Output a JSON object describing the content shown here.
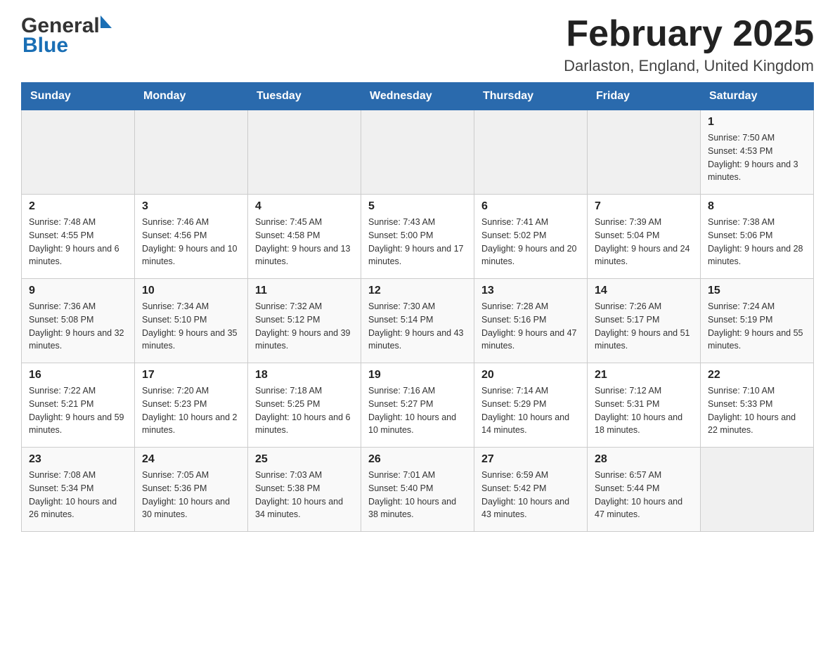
{
  "header": {
    "logo_general": "General",
    "logo_blue": "Blue",
    "month_title": "February 2025",
    "location": "Darlaston, England, United Kingdom"
  },
  "days_of_week": [
    "Sunday",
    "Monday",
    "Tuesday",
    "Wednesday",
    "Thursday",
    "Friday",
    "Saturday"
  ],
  "weeks": [
    {
      "cells": [
        {
          "day": "",
          "info": ""
        },
        {
          "day": "",
          "info": ""
        },
        {
          "day": "",
          "info": ""
        },
        {
          "day": "",
          "info": ""
        },
        {
          "day": "",
          "info": ""
        },
        {
          "day": "",
          "info": ""
        },
        {
          "day": "1",
          "info": "Sunrise: 7:50 AM\nSunset: 4:53 PM\nDaylight: 9 hours and 3 minutes."
        }
      ]
    },
    {
      "cells": [
        {
          "day": "2",
          "info": "Sunrise: 7:48 AM\nSunset: 4:55 PM\nDaylight: 9 hours and 6 minutes."
        },
        {
          "day": "3",
          "info": "Sunrise: 7:46 AM\nSunset: 4:56 PM\nDaylight: 9 hours and 10 minutes."
        },
        {
          "day": "4",
          "info": "Sunrise: 7:45 AM\nSunset: 4:58 PM\nDaylight: 9 hours and 13 minutes."
        },
        {
          "day": "5",
          "info": "Sunrise: 7:43 AM\nSunset: 5:00 PM\nDaylight: 9 hours and 17 minutes."
        },
        {
          "day": "6",
          "info": "Sunrise: 7:41 AM\nSunset: 5:02 PM\nDaylight: 9 hours and 20 minutes."
        },
        {
          "day": "7",
          "info": "Sunrise: 7:39 AM\nSunset: 5:04 PM\nDaylight: 9 hours and 24 minutes."
        },
        {
          "day": "8",
          "info": "Sunrise: 7:38 AM\nSunset: 5:06 PM\nDaylight: 9 hours and 28 minutes."
        }
      ]
    },
    {
      "cells": [
        {
          "day": "9",
          "info": "Sunrise: 7:36 AM\nSunset: 5:08 PM\nDaylight: 9 hours and 32 minutes."
        },
        {
          "day": "10",
          "info": "Sunrise: 7:34 AM\nSunset: 5:10 PM\nDaylight: 9 hours and 35 minutes."
        },
        {
          "day": "11",
          "info": "Sunrise: 7:32 AM\nSunset: 5:12 PM\nDaylight: 9 hours and 39 minutes."
        },
        {
          "day": "12",
          "info": "Sunrise: 7:30 AM\nSunset: 5:14 PM\nDaylight: 9 hours and 43 minutes."
        },
        {
          "day": "13",
          "info": "Sunrise: 7:28 AM\nSunset: 5:16 PM\nDaylight: 9 hours and 47 minutes."
        },
        {
          "day": "14",
          "info": "Sunrise: 7:26 AM\nSunset: 5:17 PM\nDaylight: 9 hours and 51 minutes."
        },
        {
          "day": "15",
          "info": "Sunrise: 7:24 AM\nSunset: 5:19 PM\nDaylight: 9 hours and 55 minutes."
        }
      ]
    },
    {
      "cells": [
        {
          "day": "16",
          "info": "Sunrise: 7:22 AM\nSunset: 5:21 PM\nDaylight: 9 hours and 59 minutes."
        },
        {
          "day": "17",
          "info": "Sunrise: 7:20 AM\nSunset: 5:23 PM\nDaylight: 10 hours and 2 minutes."
        },
        {
          "day": "18",
          "info": "Sunrise: 7:18 AM\nSunset: 5:25 PM\nDaylight: 10 hours and 6 minutes."
        },
        {
          "day": "19",
          "info": "Sunrise: 7:16 AM\nSunset: 5:27 PM\nDaylight: 10 hours and 10 minutes."
        },
        {
          "day": "20",
          "info": "Sunrise: 7:14 AM\nSunset: 5:29 PM\nDaylight: 10 hours and 14 minutes."
        },
        {
          "day": "21",
          "info": "Sunrise: 7:12 AM\nSunset: 5:31 PM\nDaylight: 10 hours and 18 minutes."
        },
        {
          "day": "22",
          "info": "Sunrise: 7:10 AM\nSunset: 5:33 PM\nDaylight: 10 hours and 22 minutes."
        }
      ]
    },
    {
      "cells": [
        {
          "day": "23",
          "info": "Sunrise: 7:08 AM\nSunset: 5:34 PM\nDaylight: 10 hours and 26 minutes."
        },
        {
          "day": "24",
          "info": "Sunrise: 7:05 AM\nSunset: 5:36 PM\nDaylight: 10 hours and 30 minutes."
        },
        {
          "day": "25",
          "info": "Sunrise: 7:03 AM\nSunset: 5:38 PM\nDaylight: 10 hours and 34 minutes."
        },
        {
          "day": "26",
          "info": "Sunrise: 7:01 AM\nSunset: 5:40 PM\nDaylight: 10 hours and 38 minutes."
        },
        {
          "day": "27",
          "info": "Sunrise: 6:59 AM\nSunset: 5:42 PM\nDaylight: 10 hours and 43 minutes."
        },
        {
          "day": "28",
          "info": "Sunrise: 6:57 AM\nSunset: 5:44 PM\nDaylight: 10 hours and 47 minutes."
        },
        {
          "day": "",
          "info": ""
        }
      ]
    }
  ]
}
